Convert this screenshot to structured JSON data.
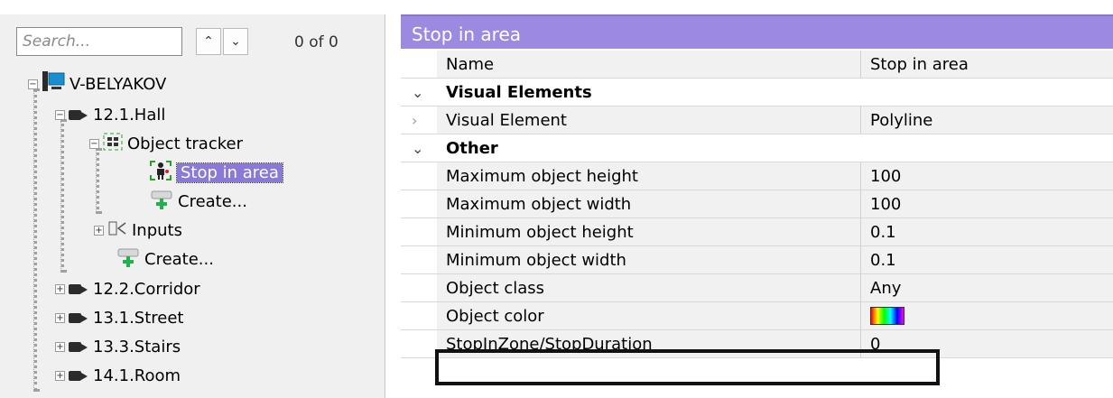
{
  "search": {
    "placeholder": "Search...",
    "match_count": "0 of 0",
    "up_glyph": "^",
    "down_glyph": "v"
  },
  "tree": {
    "root": "V-BELYAKOV",
    "items": [
      {
        "label": "12.1.Hall"
      },
      {
        "label": "Object tracker"
      },
      {
        "label": "Stop in area"
      },
      {
        "label": "Create..."
      },
      {
        "label": "Inputs"
      },
      {
        "label": "Create..."
      },
      {
        "label": "12.2.Corridor"
      },
      {
        "label": "13.1.Street"
      },
      {
        "label": "13.3.Stairs"
      },
      {
        "label": "14.1.Room"
      }
    ]
  },
  "panel": {
    "title": "Stop in area",
    "rows": [
      {
        "name": "Name",
        "value": "Stop in area"
      },
      {
        "section": "Visual Elements"
      },
      {
        "name": "Visual Element",
        "value": "Polyline"
      },
      {
        "section": "Other"
      },
      {
        "name": "Maximum object height",
        "value": "100"
      },
      {
        "name": "Maximum object width",
        "value": "100"
      },
      {
        "name": "Minimum object height",
        "value": "0.1"
      },
      {
        "name": "Minimum object width",
        "value": "0.1"
      },
      {
        "name": "Object class",
        "value": "Any"
      },
      {
        "name": "Object color",
        "value": ""
      },
      {
        "name": "StopInZone/StopDuration",
        "value": "0"
      }
    ]
  },
  "colors": {
    "header": "#9c8ae0",
    "selection": "#8a79d6"
  },
  "icons": {
    "server": "computer-icon",
    "camera": "camera-icon",
    "tracker": "object-tracker-icon",
    "zone": "person-zone-icon",
    "create": "create-plus-icon",
    "inputs": "inputs-icon"
  }
}
